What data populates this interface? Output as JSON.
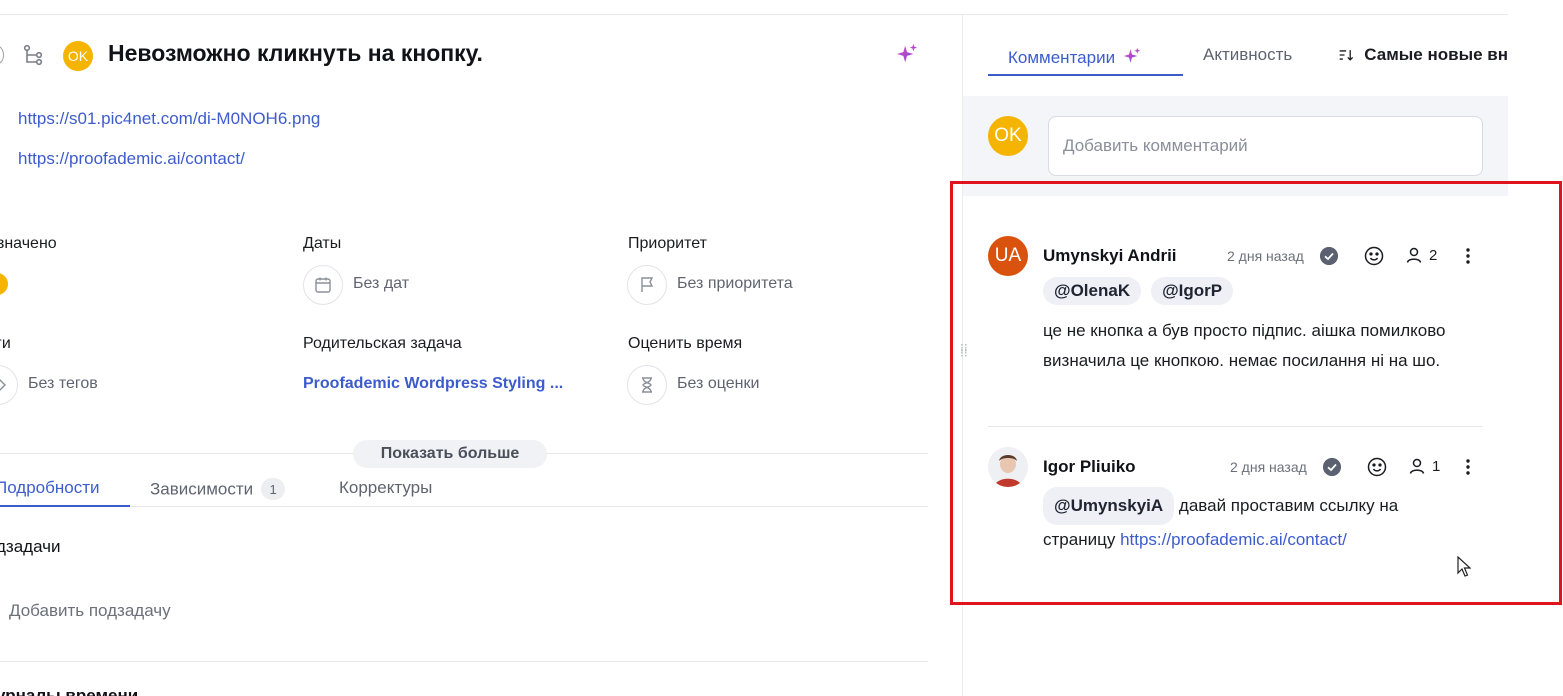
{
  "task": {
    "avatar_initials": "OK",
    "title": "Невозможно кликнуть на кнопку.",
    "links": [
      "https://s01.pic4net.com/di-M0NOH6.png",
      "https://proofademic.ai/contact/"
    ]
  },
  "fields": {
    "assigned_label": "значено",
    "dates_label": "Даты",
    "dates_value": "Без дат",
    "priority_label": "Приоритет",
    "priority_value": "Без приоритета",
    "tags_label": "ги",
    "tags_value": "Без тегов",
    "parent_label": "Родительская задача",
    "parent_value": "Proofademic Wordpress Styling ...",
    "estimate_label": "Оценить время",
    "estimate_value": "Без оценки"
  },
  "show_more_label": "Показать больше",
  "left_tabs": {
    "details": "Подробности",
    "dependencies": "Зависимости",
    "dependencies_count": "1",
    "proofing": "Корректуры"
  },
  "subtasks": {
    "heading": "дзадачи",
    "add_label": "Добавить подзадачу",
    "bottom_cut_text": "урналы времени"
  },
  "right_tabs": {
    "comments": "Комментарии",
    "activity": "Активность",
    "sort": "Самые новые вн"
  },
  "composer": {
    "avatar_initials": "OK",
    "placeholder": "Добавить комментарий"
  },
  "comments": [
    {
      "avatar_initials": "UA",
      "author": "Umynskyi Andrii",
      "time": "2 дня назад",
      "assignees": "2",
      "mentions": [
        "@OlenaK",
        "@IgorP"
      ],
      "text": "це не кнопка а був просто підпис. аішка помилково визначила це кнопкою. немає посилання ні на шо."
    },
    {
      "author": "Igor Pliuiko",
      "time": "2 дня назад",
      "assignees": "1",
      "mention": "@UmynskyiA",
      "text": "давай проставим ссылку на страницу",
      "link": "https://proofademic.ai/contact/"
    }
  ],
  "colors": {
    "accent": "#3d5ccc",
    "avatar_ok": "#f4b400",
    "avatar_ua": "#d9530f",
    "highlight_box": "#e0141c"
  }
}
